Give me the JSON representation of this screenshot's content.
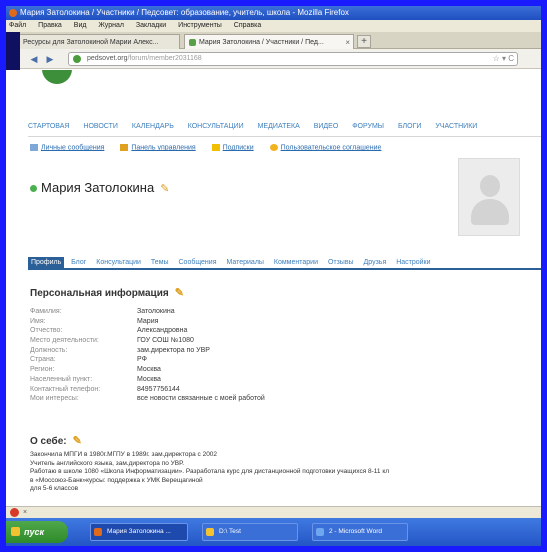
{
  "window": {
    "title": "Мария Затолокина / Участники / Педсовет: образование, учитель, школа - Mozilla Firefox"
  },
  "menubar": [
    "Файл",
    "Правка",
    "Вид",
    "Журнал",
    "Закладки",
    "Инструменты",
    "Справка"
  ],
  "tabs": [
    {
      "label": "Ресурсы для Затолокиной Марии Алекс...",
      "active": false
    },
    {
      "label": "Мария Затолокина / Участники / Пед...",
      "active": true
    }
  ],
  "addressbar": {
    "domain": "pedsovet.org",
    "path": "/forum/member2031168",
    "tools": "☆ ▾ C"
  },
  "site_nav": [
    "СТАРТОВАЯ",
    "НОВОСТИ",
    "КАЛЕНДАРЬ",
    "КОНСУЛЬТАЦИИ",
    "МЕДИАТЕКА",
    "ВИДЕО",
    "ФОРУМЫ",
    "БЛОГИ",
    "УЧАСТНИКИ"
  ],
  "actions": [
    {
      "label": "Личные сообщения",
      "icon": "mail-icon"
    },
    {
      "label": "Панель управления",
      "icon": "pencil-icon"
    },
    {
      "label": "Подписки",
      "icon": "lightning-icon"
    },
    {
      "label": "Пользовательское соглашение",
      "icon": "user-icon"
    }
  ],
  "profile": {
    "name": "Мария Затолокина",
    "edit_icon": "pencil-icon",
    "avatar": "default-avatar"
  },
  "profile_tabs": [
    "Профиль",
    "Блог",
    "Консультации",
    "Темы",
    "Сообщения",
    "Материалы",
    "Комментарии",
    "Отзывы",
    "Друзья",
    "Настройки"
  ],
  "personal": {
    "title": "Персональная информация",
    "rows": [
      {
        "label": "Фамилия:",
        "value": "Затолокина"
      },
      {
        "label": "Имя:",
        "value": "Мария"
      },
      {
        "label": "Отчество:",
        "value": "Александровна"
      },
      {
        "label": "Место деятельности:",
        "value": "ГОУ СОШ №1080"
      },
      {
        "label": "Должность:",
        "value": "зам.директора по УВР"
      },
      {
        "label": "Страна:",
        "value": "РФ"
      },
      {
        "label": "Регион:",
        "value": "Москва"
      },
      {
        "label": "Населенный пункт:",
        "value": "Москва"
      },
      {
        "label": "Контактный телефон:",
        "value": "84957756144"
      },
      {
        "label": "Мои интересы:",
        "value": "все новости связанные с моей работой"
      }
    ]
  },
  "about": {
    "title": "О себе:",
    "lines": [
      "Закончила МПГИ в 1980г.МГПУ в 1989г. зам.директора с 2002",
      "Учитель английского языка, зам.директора по УВР.",
      "Работаю в школе 1080 «Школа Информатизации». Разработала курс для дистанционной подготовки учащихся 8-11 кл",
      "в «Моссоюз-Банк»курсы: поддержка к УМК Верещагиной",
      "для 5-6 классов"
    ]
  },
  "taskbar": {
    "start_label": "пуск",
    "tasks": [
      {
        "label": "Мария Затолокина ...",
        "active": true
      },
      {
        "label": "D:\\ Test",
        "active": false
      },
      {
        "label": "2 - Microsoft Word",
        "active": false
      }
    ]
  },
  "colors": {
    "link": "#3d7fbd",
    "tab_active": "#2b5f98",
    "background": "#1a1aff"
  }
}
